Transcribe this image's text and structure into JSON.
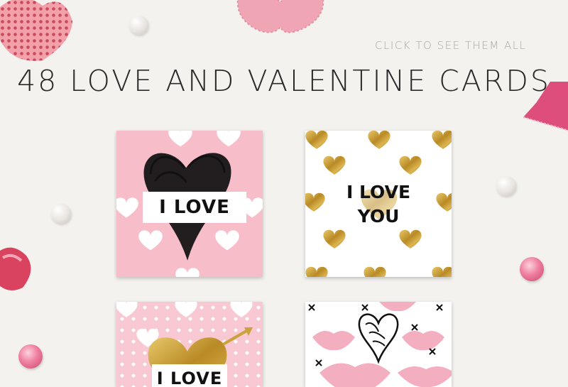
{
  "header": {
    "cta_label": "CLICK TO SEE THEM ALL",
    "title": "48 LOVE AND VALENTINE CARDS"
  },
  "cards": [
    {
      "text": "I LOVE"
    },
    {
      "line1": "I LOVE",
      "line2": "YOU"
    },
    {
      "text": "I LOVE"
    },
    {
      "text": ""
    }
  ],
  "colors": {
    "background": "#f4f2ef",
    "pink": "#f7bdc9",
    "gold": "#c9a23a",
    "ink": "#111111"
  }
}
